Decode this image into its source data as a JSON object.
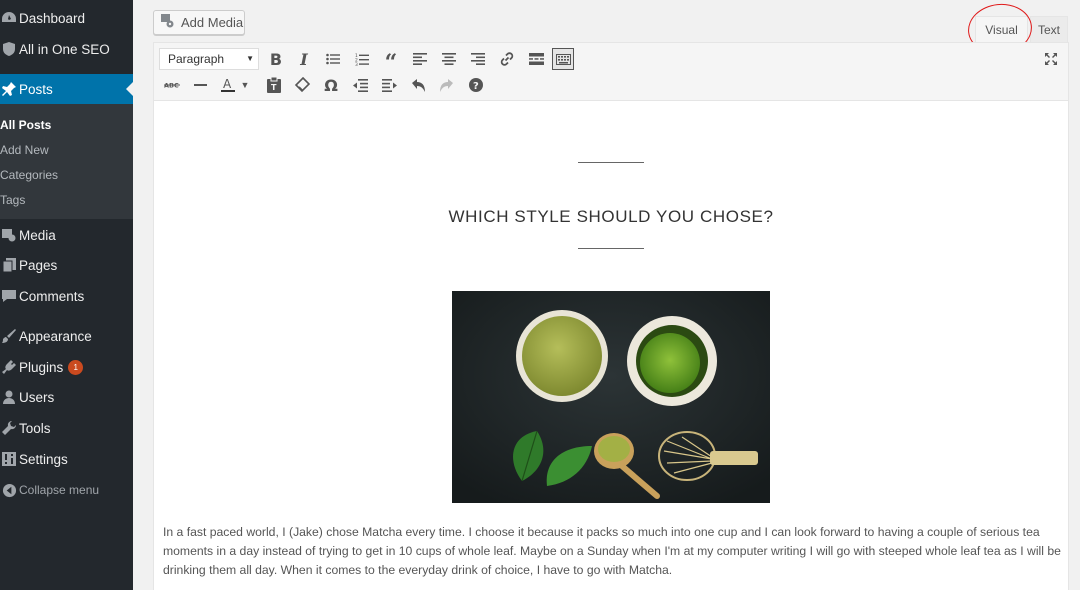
{
  "sidebar": {
    "menu": [
      {
        "id": "dashboard",
        "label": "Dashboard",
        "icon": "dashboard-icon"
      },
      {
        "id": "seo",
        "label": "All in One SEO",
        "icon": "seo-shield-icon"
      },
      {
        "id": "posts",
        "label": "Posts",
        "icon": "pushpin-icon",
        "active": true
      },
      {
        "id": "media",
        "label": "Media",
        "icon": "media-icon"
      },
      {
        "id": "pages",
        "label": "Pages",
        "icon": "pages-icon"
      },
      {
        "id": "comments",
        "label": "Comments",
        "icon": "comments-icon"
      },
      {
        "id": "appearance",
        "label": "Appearance",
        "icon": "paintbrush-icon"
      },
      {
        "id": "plugins",
        "label": "Plugins",
        "icon": "plugin-icon",
        "badge": "1"
      },
      {
        "id": "users",
        "label": "Users",
        "icon": "users-icon"
      },
      {
        "id": "tools",
        "label": "Tools",
        "icon": "wrench-icon"
      },
      {
        "id": "settings",
        "label": "Settings",
        "icon": "settings-icon"
      }
    ],
    "submenu": [
      "All Posts",
      "Add New",
      "Categories",
      "Tags"
    ],
    "collapse_label": "Collapse menu",
    "colors": {
      "background": "#23282d",
      "active": "#0073aa",
      "submenu_bg": "#32373c",
      "badge": "#ca4a1f"
    }
  },
  "editor": {
    "add_media_label": "Add Media",
    "tabs": {
      "visual": "Visual",
      "text": "Text"
    },
    "format_select": "Paragraph",
    "toolbar_row1": [
      "bold-icon",
      "italic-icon",
      "bullet-list-icon",
      "numbered-list-icon",
      "blockquote-icon",
      "align-left-icon",
      "align-center-icon",
      "align-right-icon",
      "link-icon",
      "read-more-icon",
      "toolbar-toggle-icon"
    ],
    "toolbar_row2": [
      "strikethrough-icon",
      "horizontal-line-icon",
      "text-color-icon",
      "paste-text-icon",
      "clear-formatting-icon",
      "special-character-icon",
      "outdent-icon",
      "indent-icon",
      "undo-icon",
      "redo-icon",
      "help-icon"
    ],
    "annotation_color": "#e01a1a"
  },
  "content": {
    "heading": "WHICH STYLE SHOULD YOU CHOSE?",
    "paragraph": "In a fast paced world, I (Jake) chose Matcha every time. I choose it because it packs so much into one cup and I can look forward to having a couple of serious tea moments in a day instead of trying to get in 10 cups of whole leaf. Maybe on a Sunday when I'm at my computer writing I will go with steeped whole leaf tea as I will be drinking them all day. When it comes to the everyday drink of choice, I have to go with Matcha."
  }
}
